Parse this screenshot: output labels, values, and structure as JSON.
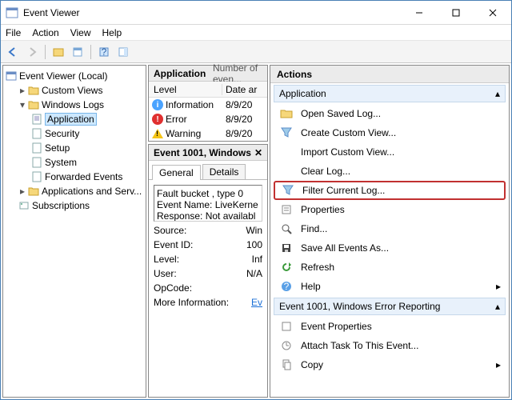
{
  "title": "Event Viewer",
  "menu": {
    "file": "File",
    "action": "Action",
    "view": "View",
    "help": "Help"
  },
  "tree": {
    "root": "Event Viewer (Local)",
    "custom_views": "Custom Views",
    "windows_logs": "Windows Logs",
    "application": "Application",
    "security": "Security",
    "setup": "Setup",
    "system": "System",
    "forwarded": "Forwarded Events",
    "app_services": "Applications and Serv...",
    "subscriptions": "Subscriptions"
  },
  "mid_top": {
    "header_title": "Application",
    "header_sub": "Number of even...",
    "col_level": "Level",
    "col_date": "Date ar",
    "rows": [
      {
        "icon": "info",
        "level": "Information",
        "date": "8/9/20"
      },
      {
        "icon": "error",
        "level": "Error",
        "date": "8/9/20"
      },
      {
        "icon": "warn",
        "level": "Warning",
        "date": "8/9/20"
      }
    ]
  },
  "mid_bot": {
    "header": "Event 1001, Windows",
    "tab_general": "General",
    "tab_details": "Details",
    "fault_text": "Fault bucket , type 0\nEvent Name: LiveKerne\nResponse: Not availabl",
    "source_k": "Source:",
    "source_v": "Win",
    "eventid_k": "Event ID:",
    "eventid_v": "100",
    "level_k": "Level:",
    "level_v": "Inf",
    "user_k": "User:",
    "user_v": "N/A",
    "opcode_k": "OpCode:",
    "moreinfo_k": "More Information:",
    "moreinfo_v": "Ev"
  },
  "actions": {
    "title": "Actions",
    "section1": "Application",
    "items1": [
      "Open Saved Log...",
      "Create Custom View...",
      "Import Custom View...",
      "Clear Log...",
      "Filter Current Log...",
      "Properties",
      "Find...",
      "Save All Events As...",
      "Refresh",
      "Help"
    ],
    "section2": "Event 1001, Windows Error Reporting",
    "items2": [
      "Event Properties",
      "Attach Task To This Event...",
      "Copy"
    ]
  }
}
